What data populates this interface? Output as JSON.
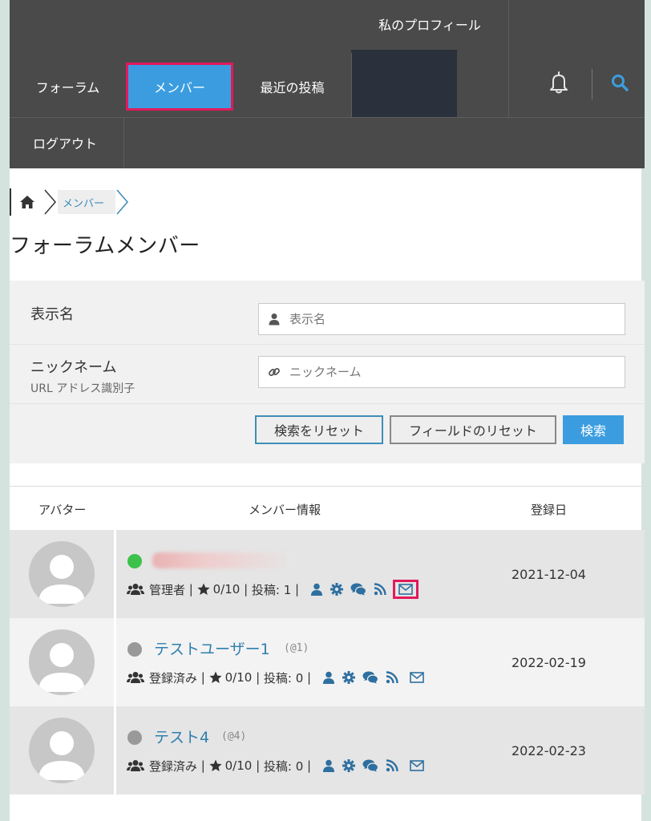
{
  "nav": {
    "profile": "私のプロフィール",
    "forum": "フォーラム",
    "members": "メンバー",
    "recent": "最近の投稿",
    "logout": "ログアウト",
    "active_bg": "#3b9ddf",
    "highlight": "#e2195b"
  },
  "breadcrumb": {
    "home_icon": "home-icon",
    "current": "メンバー"
  },
  "page_title": "フォーラムメンバー",
  "search": {
    "display_name_label": "表示名",
    "display_name_placeholder": "表示名",
    "nickname_label": "ニックネーム",
    "nickname_sub": "URL アドレス識別子",
    "nickname_placeholder": "ニックネーム",
    "reset_search": "検索をリセット",
    "reset_fields": "フィールドのリセット",
    "search": "検索"
  },
  "table": {
    "headers": {
      "avatar": "アバター",
      "info": "メンバー情報",
      "date": "登録日"
    },
    "rows": [
      {
        "name": "",
        "handle": "",
        "status_color": "#3cc24a",
        "role": "管理者",
        "rating": "0/10",
        "posts": "投稿: 1",
        "date": "2021-12-04"
      },
      {
        "name": "テストユーザー1",
        "handle": "(@1)",
        "status_color": "#999999",
        "role": "登録済み",
        "rating": "0/10",
        "posts": "投稿: 0",
        "date": "2022-02-19"
      },
      {
        "name": "テスト4",
        "handle": "(@4)",
        "status_color": "#999999",
        "role": "登録済み",
        "rating": "0/10",
        "posts": "投稿: 0",
        "date": "2022-02-23"
      }
    ]
  }
}
